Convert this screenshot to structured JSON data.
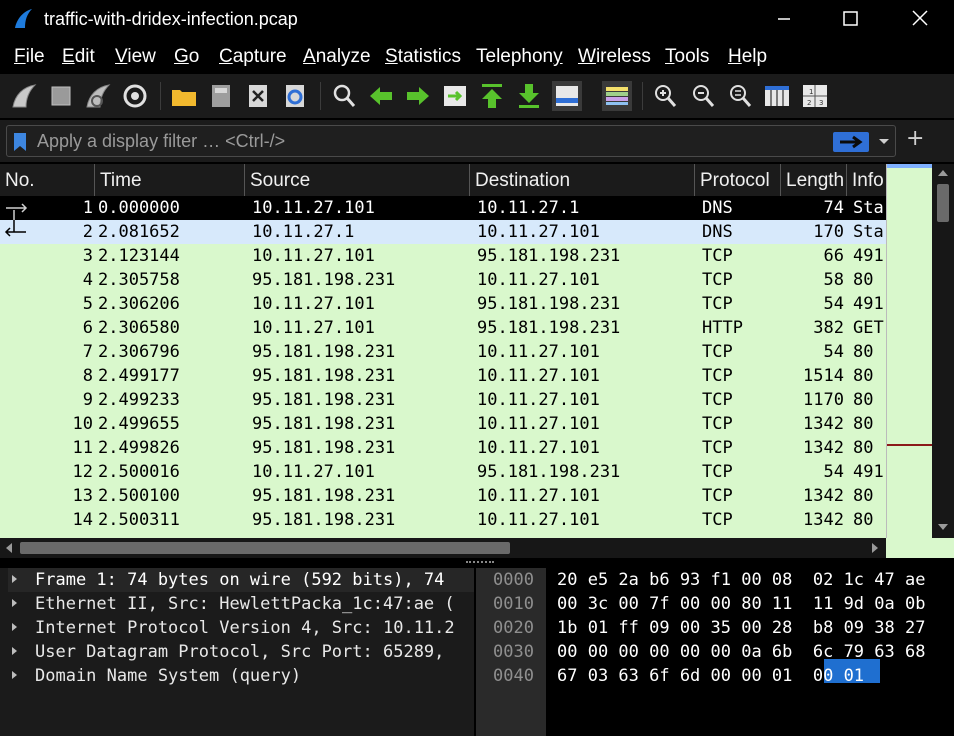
{
  "window": {
    "title": "traffic-with-dridex-infection.pcap",
    "minimize_label": "—",
    "maximize_label": "☐",
    "close_label": "✕"
  },
  "menu": [
    {
      "pre": "",
      "mnem": "F",
      "post": "ile"
    },
    {
      "pre": "",
      "mnem": "E",
      "post": "dit"
    },
    {
      "pre": "",
      "mnem": "V",
      "post": "iew"
    },
    {
      "pre": "",
      "mnem": "G",
      "post": "o"
    },
    {
      "pre": "",
      "mnem": "C",
      "post": "apture"
    },
    {
      "pre": "",
      "mnem": "A",
      "post": "nalyze"
    },
    {
      "pre": "",
      "mnem": "S",
      "post": "tatistics"
    },
    {
      "pre": "Telephon",
      "mnem": "y",
      "post": ""
    },
    {
      "pre": "",
      "mnem": "W",
      "post": "ireless"
    },
    {
      "pre": "",
      "mnem": "T",
      "post": "ools"
    },
    {
      "pre": "",
      "mnem": "H",
      "post": "elp"
    }
  ],
  "toolbar_icons": [
    "start-capture-icon",
    "stop-capture-icon",
    "restart-capture-icon",
    "capture-options-icon",
    "open-file-icon",
    "save-file-icon",
    "close-file-icon",
    "reload-file-icon",
    "find-packet-icon",
    "go-back-icon",
    "go-forward-icon",
    "go-to-packet-icon",
    "go-first-icon",
    "go-last-icon",
    "auto-scroll-icon",
    "colorize-icon",
    "zoom-in-icon",
    "zoom-out-icon",
    "normal-size-icon",
    "resize-columns-icon",
    "split-columns-icon"
  ],
  "filter": {
    "placeholder": "Apply a display filter … <Ctrl-/>",
    "value": ""
  },
  "columns": [
    "No.",
    "Time",
    "Source",
    "Destination",
    "Protocol",
    "Length",
    "Info"
  ],
  "packets": [
    {
      "no": "1",
      "time": "0.000000",
      "src": "10.11.27.101",
      "dst": "10.11.27.1",
      "proto": "DNS",
      "len": "74",
      "info": "Sta"
    },
    {
      "no": "2",
      "time": "2.081652",
      "src": "10.11.27.1",
      "dst": "10.11.27.101",
      "proto": "DNS",
      "len": "170",
      "info": "Sta"
    },
    {
      "no": "3",
      "time": "2.123144",
      "src": "10.11.27.101",
      "dst": "95.181.198.231",
      "proto": "TCP",
      "len": "66",
      "info": "491"
    },
    {
      "no": "4",
      "time": "2.305758",
      "src": "95.181.198.231",
      "dst": "10.11.27.101",
      "proto": "TCP",
      "len": "58",
      "info": "80 -"
    },
    {
      "no": "5",
      "time": "2.306206",
      "src": "10.11.27.101",
      "dst": "95.181.198.231",
      "proto": "TCP",
      "len": "54",
      "info": "491"
    },
    {
      "no": "6",
      "time": "2.306580",
      "src": "10.11.27.101",
      "dst": "95.181.198.231",
      "proto": "HTTP",
      "len": "382",
      "info": "GET"
    },
    {
      "no": "7",
      "time": "2.306796",
      "src": "95.181.198.231",
      "dst": "10.11.27.101",
      "proto": "TCP",
      "len": "54",
      "info": "80 -"
    },
    {
      "no": "8",
      "time": "2.499177",
      "src": "95.181.198.231",
      "dst": "10.11.27.101",
      "proto": "TCP",
      "len": "1514",
      "info": "80 -"
    },
    {
      "no": "9",
      "time": "2.499233",
      "src": "95.181.198.231",
      "dst": "10.11.27.101",
      "proto": "TCP",
      "len": "1170",
      "info": "80 -"
    },
    {
      "no": "10",
      "time": "2.499655",
      "src": "95.181.198.231",
      "dst": "10.11.27.101",
      "proto": "TCP",
      "len": "1342",
      "info": "80 -"
    },
    {
      "no": "11",
      "time": "2.499826",
      "src": "95.181.198.231",
      "dst": "10.11.27.101",
      "proto": "TCP",
      "len": "1342",
      "info": "80 -"
    },
    {
      "no": "12",
      "time": "2.500016",
      "src": "10.11.27.101",
      "dst": "95.181.198.231",
      "proto": "TCP",
      "len": "54",
      "info": "491"
    },
    {
      "no": "13",
      "time": "2.500100",
      "src": "95.181.198.231",
      "dst": "10.11.27.101",
      "proto": "TCP",
      "len": "1342",
      "info": "80 -"
    },
    {
      "no": "14",
      "time": "2.500311",
      "src": "95.181.198.231",
      "dst": "10.11.27.101",
      "proto": "TCP",
      "len": "1342",
      "info": "80 -"
    }
  ],
  "details": [
    "Frame 1: 74 bytes on wire (592 bits), 74",
    "Ethernet II, Src: HewlettPacka_1c:47:ae (",
    "Internet Protocol Version 4, Src: 10.11.2",
    "User Datagram Protocol, Src Port: 65289,",
    "Domain Name System (query)"
  ],
  "bytes": {
    "offsets": [
      "0000",
      "0010",
      "0020",
      "0030",
      "0040"
    ],
    "hex": [
      "20 e5 2a b6 93 f1 00 08  02 1c 47 ae",
      "00 3c 00 7f 00 00 80 11  11 9d 0a 0b",
      "1b 01 ff 09 00 35 00 28  b8 09 38 27",
      "00 00 00 00 00 00 0a 6b  6c 79 63 68",
      "67 03 63 6f 6d 00 00 01  00 01"
    ]
  },
  "colors": {
    "row_bg": "#d9f8cc",
    "selected_bg": "#000000",
    "related_bg": "#d7e9fb",
    "accent": "#1f6fd0"
  }
}
